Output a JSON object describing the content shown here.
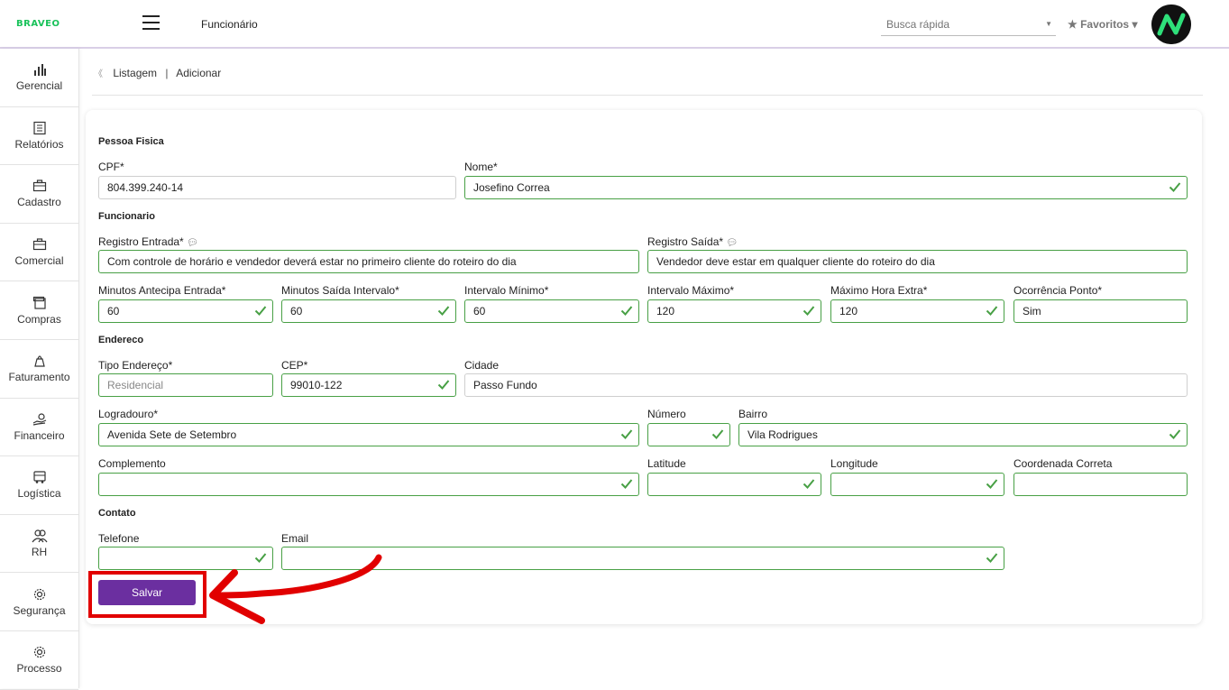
{
  "header": {
    "logo": "BRAVEO",
    "page_name": "Funcionário",
    "search_placeholder": "Busca rápida",
    "favorites_label": "★ Favoritos ▾"
  },
  "sidebar": {
    "items": [
      {
        "label": "Gerencial",
        "icon": "chart-icon"
      },
      {
        "label": "Relatórios",
        "icon": "report-icon"
      },
      {
        "label": "Cadastro",
        "icon": "briefcase-icon"
      },
      {
        "label": "Comercial",
        "icon": "briefcase-icon"
      },
      {
        "label": "Compras",
        "icon": "cart-icon"
      },
      {
        "label": "Faturamento",
        "icon": "bag-icon"
      },
      {
        "label": "Financeiro",
        "icon": "money-hand-icon"
      },
      {
        "label": "Logística",
        "icon": "truck-icon"
      },
      {
        "label": "RH",
        "icon": "people-icon"
      },
      {
        "label": "Segurança",
        "icon": "gear-icon"
      },
      {
        "label": "Processo",
        "icon": "gear-icon"
      }
    ]
  },
  "breadcrumb": {
    "listagem": "Listagem",
    "separator": "|",
    "current": "Adicionar"
  },
  "form": {
    "pessoa_fisica": {
      "title": "Pessoa Fisica",
      "cpf_label": "CPF*",
      "cpf_value": "804.399.240-14",
      "nome_label": "Nome*",
      "nome_value": "Josefino Correa"
    },
    "funcionario": {
      "title": "Funcionario",
      "registro_entrada_label": "Registro Entrada*",
      "registro_entrada_value": "Com controle de horário e vendedor deverá estar no primeiro cliente do roteiro do dia",
      "registro_saida_label": "Registro Saída*",
      "registro_saida_value": "Vendedor deve estar em qualquer cliente do roteiro do dia",
      "minutos_antecipa_label": "Minutos Antecipa Entrada*",
      "minutos_antecipa_value": "60",
      "minutos_saida_label": "Minutos Saída Intervalo*",
      "minutos_saida_value": "60",
      "intervalo_minimo_label": "Intervalo Mínimo*",
      "intervalo_minimo_value": "60",
      "intervalo_maximo_label": "Intervalo Máximo*",
      "intervalo_maximo_value": "120",
      "maximo_hora_extra_label": "Máximo Hora Extra*",
      "maximo_hora_extra_value": "120",
      "ocorrencia_ponto_label": "Ocorrência Ponto*",
      "ocorrencia_ponto_value": "Sim"
    },
    "endereco": {
      "title": "Endereco",
      "tipo_label": "Tipo Endereço*",
      "tipo_placeholder": "Residencial",
      "cep_label": "CEP*",
      "cep_value": "99010-122",
      "cidade_label": "Cidade",
      "cidade_value": "Passo Fundo",
      "logradouro_label": "Logradouro*",
      "logradouro_value": "Avenida Sete de Setembro",
      "numero_label": "Número",
      "numero_value": "",
      "bairro_label": "Bairro",
      "bairro_value": "Vila Rodrigues",
      "complemento_label": "Complemento",
      "complemento_value": "",
      "latitude_label": "Latitude",
      "latitude_value": "",
      "longitude_label": "Longitude",
      "longitude_value": "",
      "coordenada_label": "Coordenada Correta",
      "coordenada_value": ""
    },
    "contato": {
      "title": "Contato",
      "telefone_label": "Telefone",
      "telefone_value": "",
      "email_label": "Email",
      "email_value": ""
    },
    "save_label": "Salvar"
  },
  "colors": {
    "brand_green": "#19c25a",
    "primary_purple": "#6b2fa0",
    "valid_green": "#48a045",
    "highlight_red": "#e10000"
  }
}
